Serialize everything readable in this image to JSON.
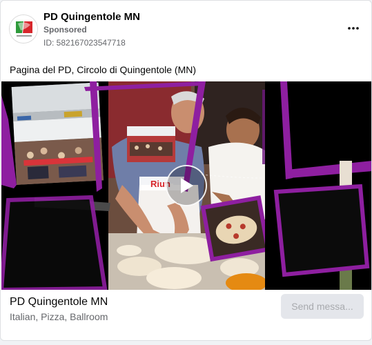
{
  "post": {
    "page_name": "PD Quingentole MN",
    "sponsored": "Sponsored",
    "ad_id": "ID: 582167023547718",
    "more_icon": "more-horizontal-icon",
    "ad_text": "Pagina del PD, Circolo di Quingentole (MN)"
  },
  "avatar": {
    "logo_text": "PD"
  },
  "media": {
    "sign_text": "Riun",
    "play_icon": "play-icon"
  },
  "footer": {
    "title": "PD Quingentole MN",
    "subtitle": "Italian, Pizza, Ballroom",
    "cta_label": "Send messa..."
  },
  "colors": {
    "accent_purple": "#8e1fa0",
    "logo_green": "#2e9a3a",
    "logo_red": "#d7262b",
    "button_bg": "#e4e6eb",
    "button_text": "#a8aaae"
  }
}
